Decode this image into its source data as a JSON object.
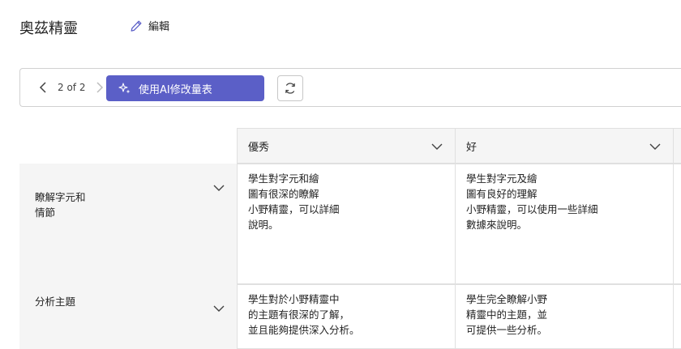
{
  "page": {
    "title": "奧茲精靈",
    "edit_label": "編輯"
  },
  "toolbar": {
    "pager_text": "2 of 2",
    "ai_button_label": "使用AI修改量表"
  },
  "rubric": {
    "levels": [
      {
        "label": "優秀"
      },
      {
        "label": "好"
      }
    ],
    "criteria": [
      {
        "label": "瞭解字元和\n情節",
        "cells": [
          "學生對字元和繪\n圖有很深的瞭解\n小野精靈，可以詳細\n說明。",
          "學生對字元及繪\n圖有良好的理解\n小野精靈，可以使用一些詳細\n數據來說明。"
        ]
      },
      {
        "label": "分析主題",
        "cells": [
          "學生對於小野精靈中\n的主題有很深的了解，\n並且能夠提供深入分析。",
          "學生完全瞭解小野\n精靈中的主題，並\n可提供一些分析。"
        ]
      }
    ]
  },
  "colors": {
    "accent": "#5b5fc7",
    "header_bg": "#f5f5f5",
    "border": "#e0e0e0"
  }
}
